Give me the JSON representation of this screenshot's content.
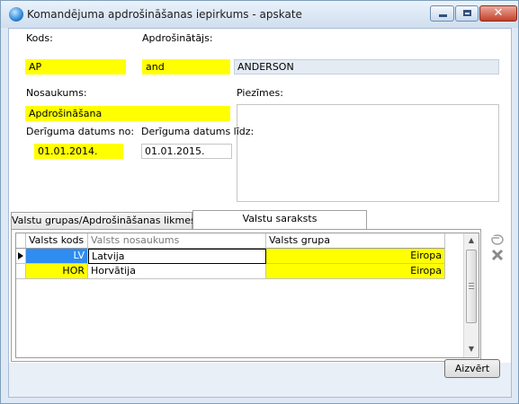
{
  "window": {
    "title": "Komandējuma apdrošināšanas iepirkums - apskate"
  },
  "form": {
    "kods_label": "Kods:",
    "kods_value": "AP",
    "apdrosinatajs_label": "Apdrošinātājs:",
    "apdrosinatajs_code": "and",
    "apdrosinatajs_name": "ANDERSON",
    "nosaukums_label": "Nosaukums:",
    "nosaukums_value": "Apdrošināšana",
    "piezimes_label": "Piezīmes:",
    "derigs_no_label": "Derīguma datums no:",
    "derigs_no_value": "01.01.2014.",
    "derigs_lidz_label": "Derīguma datums līdz:",
    "derigs_lidz_value": "01.01.2015."
  },
  "tabs": [
    {
      "label": "Valstu grupas/Apdrošināšanas likmes"
    },
    {
      "label": "Valstu saraksts"
    }
  ],
  "grid": {
    "columns": [
      "Valsts kods",
      "Valsts nosaukums",
      "Valsts grupa"
    ],
    "rows": [
      {
        "code": "LV",
        "name": "Latvija",
        "group": "Eiropa"
      },
      {
        "code": "HOR",
        "name": "Horvātija",
        "group": "Eiropa"
      }
    ]
  },
  "buttons": {
    "close_label": "Aizvērt"
  },
  "colors": {
    "required_field": "#ffff00",
    "selected_cell": "#2f8cf0"
  }
}
